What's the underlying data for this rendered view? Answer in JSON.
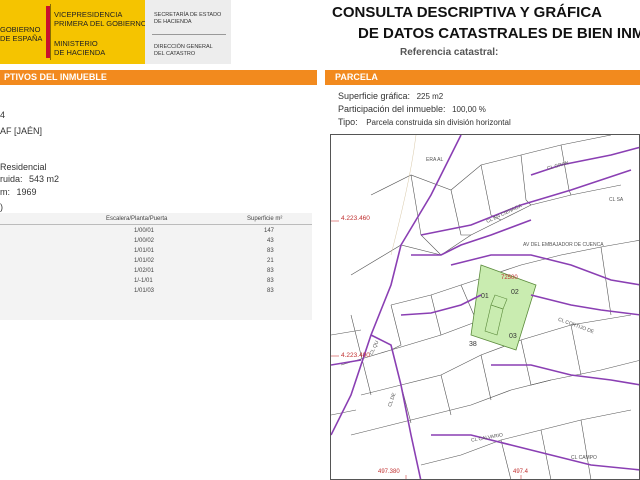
{
  "header": {
    "gov_line1": "GOBIERNO",
    "gov_line2": "DE ESPAÑA",
    "vice_line1": "VICEPRESIDENCIA",
    "vice_line2": "PRIMERA DEL GOBIERNO",
    "min_line1": "MINISTERIO",
    "min_line2": "DE HACIENDA",
    "sec_line1": "SECRETARÍA DE ESTADO",
    "sec_line2": "DE HACIENDA",
    "dir_line1": "DIRECCIÓN GENERAL",
    "dir_line2": "DEL CATASTRO",
    "title_line1": "CONSULTA DESCRIPTIVA Y GRÁFICA",
    "title_line2": "DE DATOS CATASTRALES DE BIEN INMUE",
    "ref_label": "Referencia catastral:"
  },
  "left_panel": {
    "section_title": "PTIVOS DEL INMUEBLE",
    "line_number": "4",
    "municipality": "AF [JAÉN]",
    "use": "Residencial",
    "built_area_label": "ruida:",
    "built_area_value": "543 m2",
    "year_label": "m:",
    "year_value": "1969",
    "bracket_mark": ")",
    "table": {
      "col_stair": "Escalera/Planta/Puerta",
      "col_area": "Superficie m²",
      "rows": [
        {
          "pos": "1/00/01",
          "area": "147"
        },
        {
          "pos": "1/00/02",
          "area": "43"
        },
        {
          "pos": "1/01/01",
          "area": "83"
        },
        {
          "pos": "1/01/02",
          "area": "21"
        },
        {
          "pos": "1/02/01",
          "area": "83"
        },
        {
          "pos": "1/-1/01",
          "area": "83"
        },
        {
          "pos": "1/01/03",
          "area": "83"
        }
      ]
    }
  },
  "right_panel": {
    "section_title": "PARCELA",
    "surface_label": "Superficie gráfica:",
    "surface_value": "225 m2",
    "participation_label": "Participación del inmueble:",
    "participation_value": "100,00 %",
    "type_label": "Tipo:",
    "type_value": "Parcela construida sin división horizontal"
  },
  "map": {
    "coord_1": "4.223.460",
    "coord_2": "4.223.400",
    "coord_bottom_1": "497.380",
    "coord_bottom_2": "497.4",
    "street_1": "ERA AL",
    "street_2": "CL GRAN",
    "street_3": "CL EN CIENAGA",
    "street_4": "CL SA",
    "street_5": "AV DEL EMBAJADOR DE CUENCA",
    "street_6": "CL CORTIJO DE",
    "street_7": "CL CALVARIO",
    "street_8": "CL CAMPO",
    "street_9": "CL DE",
    "street_10": "CL QU",
    "parcel_01": "01",
    "parcel_02": "02",
    "parcel_03": "03",
    "parcel_38": "38",
    "parcel_code": "72500",
    "highlight_color": "#c9ecb0",
    "street_color": "#8a3fb3"
  },
  "colors": {
    "orange": "#f28a1e",
    "gov_yellow": "#f5c400",
    "gov_red": "#c8102e"
  }
}
